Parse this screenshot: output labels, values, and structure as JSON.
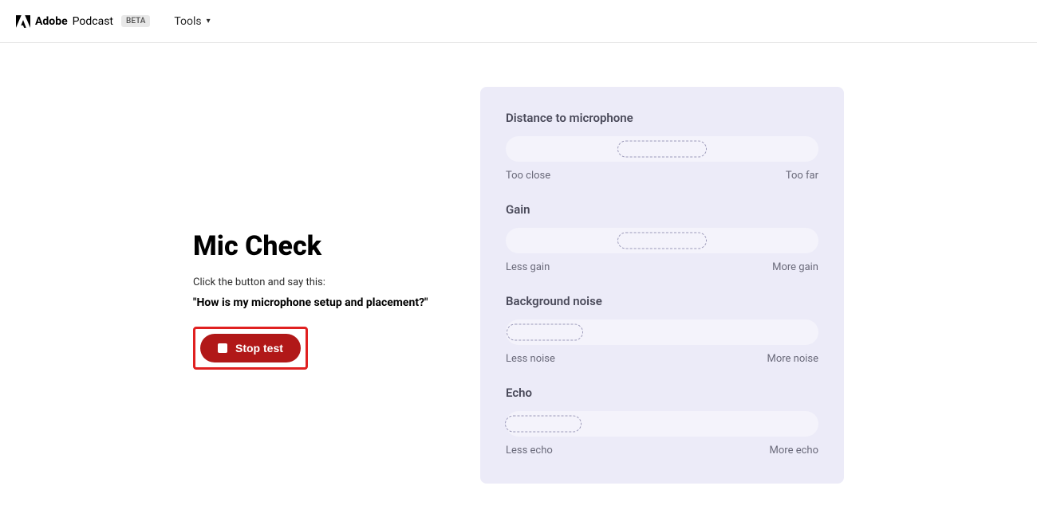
{
  "header": {
    "brand_bold": "Adobe",
    "brand_light": "Podcast",
    "beta": "BETA",
    "tools": "Tools"
  },
  "left": {
    "title": "Mic Check",
    "instruction": "Click the button and say this:",
    "phrase": "\"How is my microphone setup and placement?\"",
    "stop_button": "Stop test"
  },
  "metrics": [
    {
      "title": "Distance to microphone",
      "left_label": "Too close",
      "right_label": "Too far",
      "indicator_class": "indicator indicator-wide indicator-center"
    },
    {
      "title": "Gain",
      "left_label": "Less gain",
      "right_label": "More gain",
      "indicator_class": "indicator indicator-wide indicator-center"
    },
    {
      "title": "Background noise",
      "left_label": "Less noise",
      "right_label": "More noise",
      "indicator_class": "indicator indicator-narrow indicator-left"
    },
    {
      "title": "Echo",
      "left_label": "Less echo",
      "right_label": "More echo",
      "indicator_class": "indicator indicator-narrow indicator-left-narrow"
    }
  ]
}
